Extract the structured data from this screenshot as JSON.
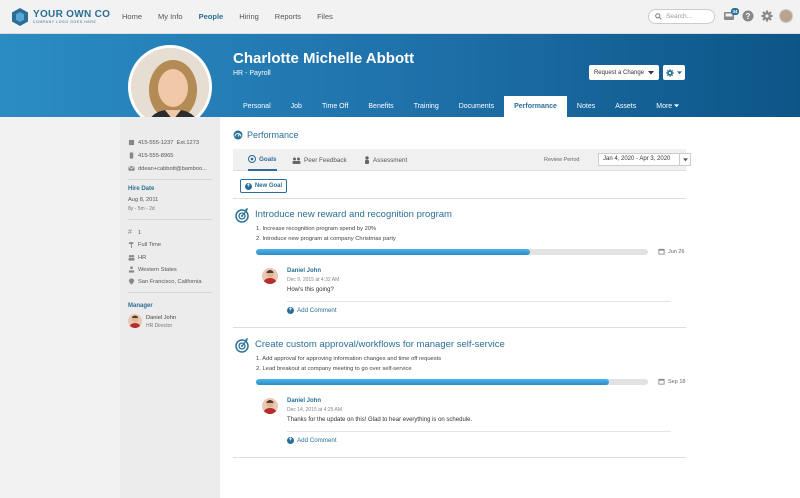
{
  "brand": {
    "name": "YOUR OWN CO",
    "tagline": "COMPANY LOGO GOES HERE"
  },
  "nav": {
    "items": [
      "Home",
      "My Info",
      "People",
      "Hiring",
      "Reports",
      "Files"
    ],
    "active": "People"
  },
  "search": {
    "placeholder": "Search..."
  },
  "notifications": {
    "count": "34"
  },
  "employee": {
    "name": "Charlotte Michelle Abbott",
    "title": "HR - Payroll"
  },
  "actions": {
    "request_change": "Request a Change"
  },
  "tabs": [
    "Personal",
    "Job",
    "Time Off",
    "Benefits",
    "Training",
    "Documents",
    "Performance",
    "Notes",
    "Assets",
    "More"
  ],
  "sidebar": {
    "work_phone": "415-555-1237",
    "ext": "Ext.1273",
    "mobile": "415-555-8965",
    "email": "ddean+cabbott@bamboo...",
    "hire_date_label": "Hire Date",
    "hire_date": "Aug 8, 2011",
    "tenure": "8y - 5m - 2d",
    "employee_num": "1",
    "employment_status": "Full Time",
    "department": "HR",
    "division": "Western States",
    "location": "San Francisco, California",
    "manager_label": "Manager",
    "manager_name": "Daniel John",
    "manager_title": "HR Director"
  },
  "performance": {
    "title": "Performance",
    "subtabs": [
      "Goals",
      "Peer Feedback",
      "Assessment"
    ],
    "review_period_label": "Review Period",
    "review_period": "Jan 4, 2020 - Apr 3, 2020",
    "new_goal": "New Goal",
    "add_comment": "Add Comment",
    "goals": [
      {
        "title": "Introduce new reward and recognition program",
        "lines": [
          "1. Increase recognition program spend by 20%",
          "2. Introduce new program at company Christmas party"
        ],
        "progress": 0.7,
        "due": "Jun 26",
        "comment": {
          "author": "Daniel John",
          "date": "Dec 9, 2015 at 4:32 AM",
          "text": "How's this going?"
        }
      },
      {
        "title": "Create custom approval/workflows for manager self-service",
        "lines": [
          "1. Add approval for approving information changes and time off requests",
          "2. Lead breakout at company meeting to go over self-service"
        ],
        "progress": 0.9,
        "due": "Sep 18",
        "comment": {
          "author": "Daniel John",
          "date": "Dec 14, 2015 at 4:25 AM",
          "text": "Thanks for the update on this!  Glad to hear everything is on schedule."
        }
      }
    ]
  },
  "colors": {
    "accent": "#2a6f97",
    "header_start": "#2b8cc4",
    "header_end": "#0c5587",
    "progress": "#3ba3db"
  }
}
